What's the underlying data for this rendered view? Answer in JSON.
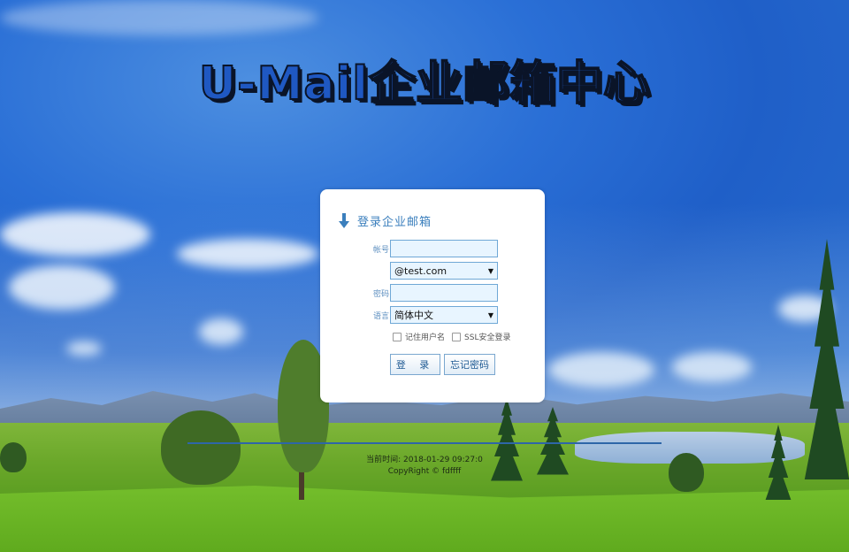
{
  "title": "U-Mail企业邮箱中心",
  "login": {
    "header": "登录企业邮箱",
    "account_label": "帐号",
    "account_value": "",
    "domain_value": "@test.com",
    "password_label": "密码",
    "password_value": "",
    "language_label": "语言",
    "language_value": "简体中文",
    "remember_label": "记住用户名",
    "ssl_label": "SSL安全登录",
    "login_button": "登 录",
    "forgot_button": "忘记密码"
  },
  "footer": {
    "time_text": "当前时间: 2018-01-29 09:27:0",
    "copyright": "CopyRight © fdffff"
  },
  "colors": {
    "accent": "#3b7fbd",
    "field_border": "#6fa8d6",
    "field_bg": "#e8f5ff"
  }
}
